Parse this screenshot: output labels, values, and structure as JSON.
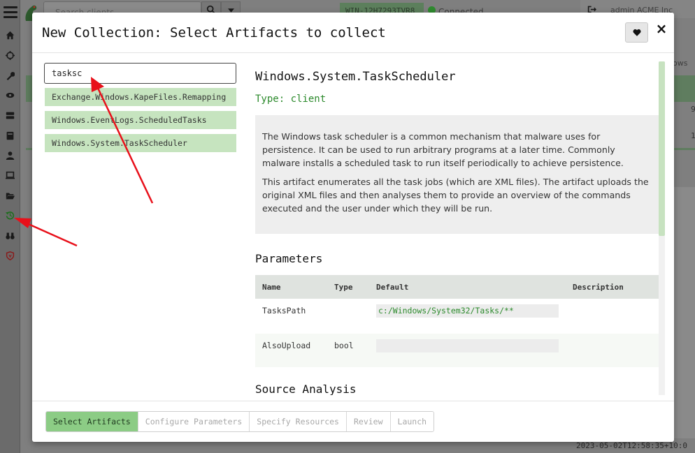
{
  "app": {
    "search_placeholder": "Search clients",
    "client_id": "WIN-12H7293TVR8",
    "connection_status": "Connected",
    "user": "admin ACME Inc",
    "columns_hint": "ows",
    "cell_a": "9",
    "cell_b": "1",
    "timestamp": "2023-05-02T12:58:35+10:0"
  },
  "modal": {
    "title": "New Collection: Select Artifacts to collect",
    "favorite_icon": "heart-icon",
    "close_label": "×"
  },
  "search": {
    "value": "tasksc"
  },
  "results": [
    {
      "label": "Exchange.Windows.KapeFiles.Remapping"
    },
    {
      "label": "Windows.EventLogs.ScheduledTasks"
    },
    {
      "label": "Windows.System.TaskScheduler"
    }
  ],
  "artifact": {
    "name": "Windows.System.TaskScheduler",
    "type": "Type: client",
    "description_1": "The Windows task scheduler is a common mechanism that malware uses for persistence. It can be used to run arbitrary programs at a later time. Commonly malware installs a scheduled task to run itself periodically to achieve persistence.",
    "description_2": "This artifact enumerates all the task jobs (which are XML files). The artifact uploads the original XML files and then analyses them to provide an overview of the commands executed and the user under which they will be run.",
    "parameters_title": "Parameters",
    "param_headers": {
      "name": "Name",
      "type": "Type",
      "default": "Default",
      "description": "Description"
    },
    "params": [
      {
        "name": "TasksPath",
        "type": "",
        "default": "c:/Windows/System32/Tasks/**",
        "description": ""
      },
      {
        "name": "AlsoUpload",
        "type": "bool",
        "default": "",
        "description": ""
      }
    ],
    "source_title": "Source Analysis"
  },
  "steps": [
    {
      "label": "Select Artifacts"
    },
    {
      "label": "Configure Parameters"
    },
    {
      "label": "Specify Resources"
    },
    {
      "label": "Review"
    },
    {
      "label": "Launch"
    }
  ],
  "colors": {
    "accent_green": "#8ccc85",
    "result_green": "#c6e4bf",
    "type_green": "#2c8a2c",
    "annotation_red": "#e8101a"
  }
}
